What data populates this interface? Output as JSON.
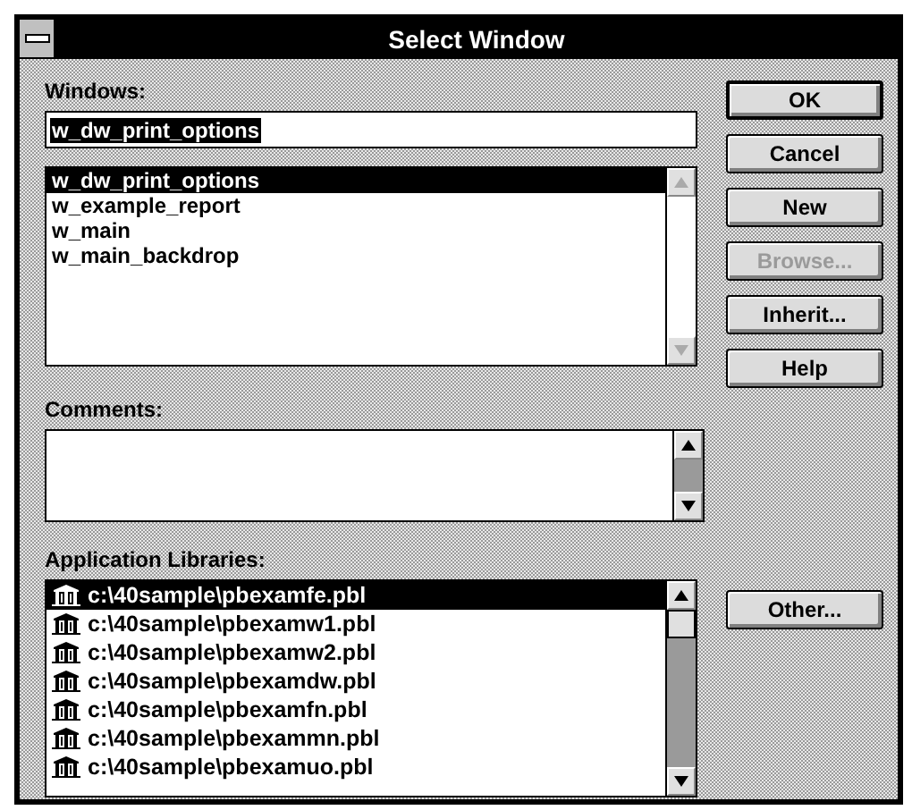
{
  "window": {
    "title": "Select Window"
  },
  "windows_label": "Windows:",
  "window_name": {
    "value": "w_dw_print_options",
    "value_selected": true
  },
  "windows_list": [
    {
      "label": "w_dw_print_options",
      "selected": true
    },
    {
      "label": "w_example_report",
      "selected": false
    },
    {
      "label": "w_main",
      "selected": false
    },
    {
      "label": "w_main_backdrop",
      "selected": false
    }
  ],
  "buttons": [
    {
      "label": "OK",
      "disabled": false,
      "default": true
    },
    {
      "label": "Cancel",
      "disabled": false,
      "default": false
    },
    {
      "label": "New",
      "disabled": false,
      "default": false
    },
    {
      "label": "Browse...",
      "disabled": true,
      "default": false
    },
    {
      "label": "Inherit...",
      "disabled": false,
      "default": false
    },
    {
      "label": "Help",
      "disabled": false,
      "default": false
    }
  ],
  "comments_label": "Comments:",
  "libraries_label": "Application Libraries:",
  "libraries": [
    {
      "label": "c:\\40sample\\pbexamfe.pbl",
      "selected": true
    },
    {
      "label": "c:\\40sample\\pbexamw1.pbl",
      "selected": false
    },
    {
      "label": "c:\\40sample\\pbexamw2.pbl",
      "selected": false
    },
    {
      "label": "c:\\40sample\\pbexamdw.pbl",
      "selected": false
    },
    {
      "label": "c:\\40sample\\pbexamfn.pbl",
      "selected": false
    },
    {
      "label": "c:\\40sample\\pbexammn.pbl",
      "selected": false
    },
    {
      "label": "c:\\40sample\\pbexamuo.pbl",
      "selected": false
    }
  ],
  "other_button": {
    "label": "Other...",
    "disabled": false
  }
}
